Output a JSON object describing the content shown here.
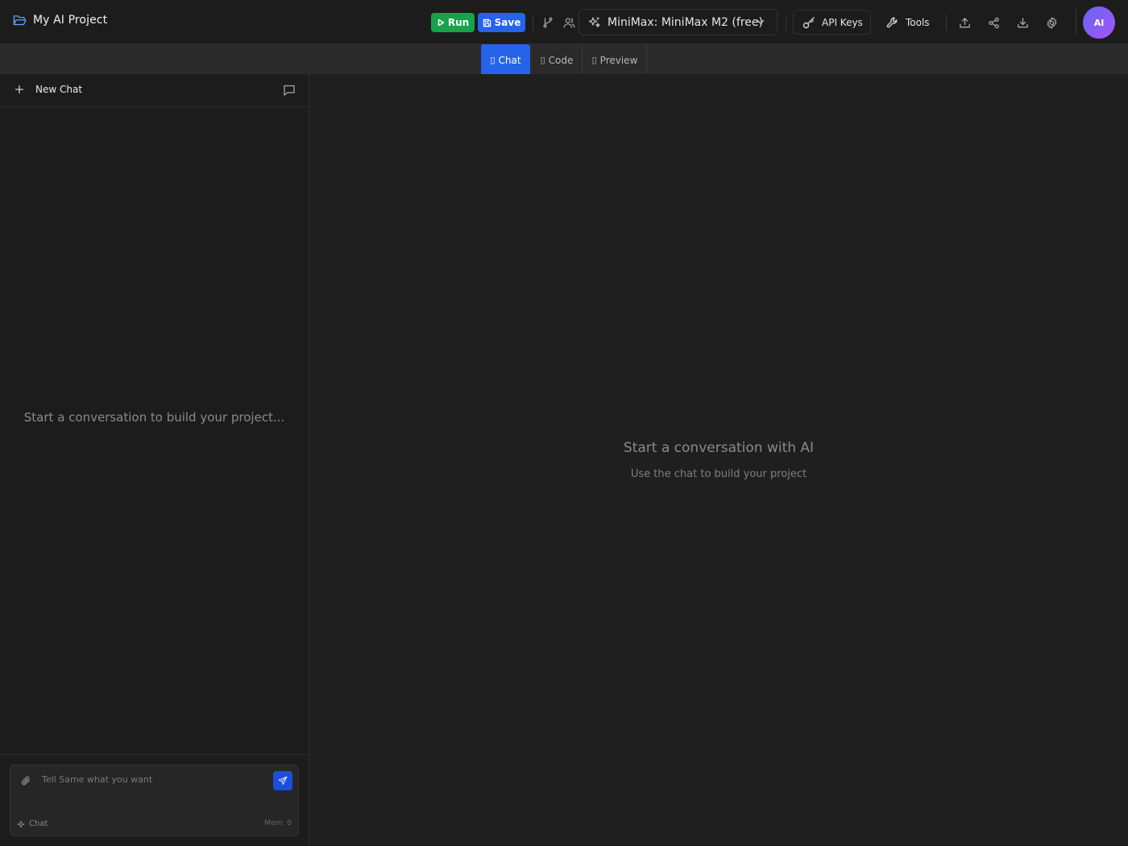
{
  "project": {
    "title": "My AI Project"
  },
  "toolbar": {
    "run_label": "Run",
    "save_label": "Save",
    "model_label": "MiniMax: MiniMax M2 (free)",
    "api_keys_label": "API Keys",
    "tools_label": "Tools",
    "avatar_initials": "AI"
  },
  "tabs": [
    {
      "label": "Chat",
      "active": true
    },
    {
      "label": "Code",
      "active": false
    },
    {
      "label": "Preview",
      "active": false
    }
  ],
  "sidebar": {
    "new_chat_label": "New Chat",
    "empty_text": "Start a conversation to build your project..."
  },
  "composer": {
    "placeholder": "Tell Same what you want",
    "mode_label": "Chat",
    "memory_label": "Mem: 0"
  },
  "main": {
    "title": "Start a conversation with AI",
    "subtitle": "Use the chat to build your project"
  },
  "colors": {
    "run": "#16a34a",
    "save": "#2563eb",
    "active_tab": "#2563eb",
    "avatar_from": "#6366f1",
    "avatar_to": "#a855f7",
    "background": "#1f1f1f"
  },
  "icons": [
    "folder-open-icon",
    "play-icon",
    "save-icon",
    "git-branch-icon",
    "users-icon",
    "sparkles-icon",
    "chevron-down-icon",
    "key-icon",
    "wrench-icon",
    "upload-icon",
    "share-icon",
    "download-icon",
    "settings-icon",
    "plus-icon",
    "message-square-icon",
    "paperclip-icon",
    "send-icon"
  ]
}
